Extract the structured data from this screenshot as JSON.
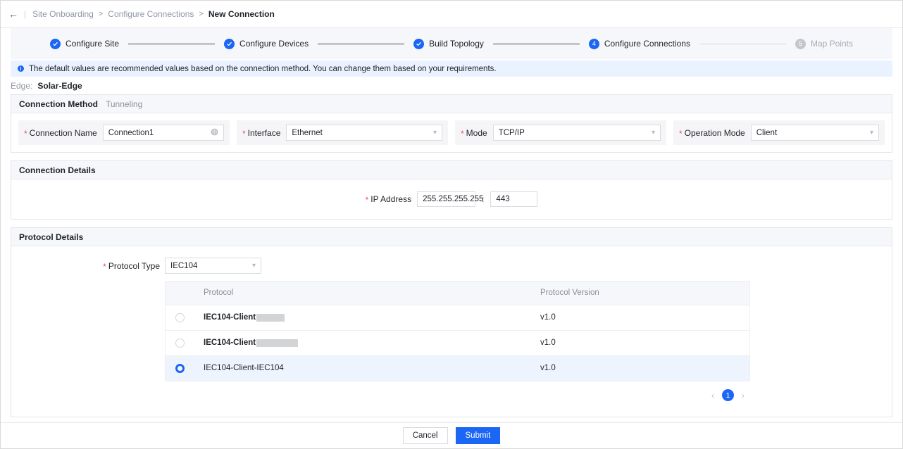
{
  "breadcrumb": {
    "back_icon": "back-arrow-icon",
    "items": [
      "Site Onboarding",
      "Configure Connections"
    ],
    "current": "New Connection",
    "separator": ">"
  },
  "stepper": {
    "steps": [
      {
        "label": "Configure Site",
        "state": "done",
        "marker": "check"
      },
      {
        "label": "Configure Devices",
        "state": "done",
        "marker": "check"
      },
      {
        "label": "Build Topology",
        "state": "done",
        "marker": "check"
      },
      {
        "label": "Configure Connections",
        "state": "active",
        "marker": "4"
      },
      {
        "label": "Map Points",
        "state": "inactive",
        "marker": "5"
      }
    ]
  },
  "info_banner": {
    "icon": "info-circle-icon",
    "text": "The default values are recommended values based on the connection method. You can change them based on your requirements."
  },
  "edge": {
    "label": "Edge:",
    "value": "Solar-Edge"
  },
  "connection_method": {
    "title": "Connection Method",
    "subtitle": "Tunneling",
    "fields": {
      "connection_name": {
        "label": "Connection Name",
        "required": true,
        "value": "Connection1",
        "icon": "globe-icon"
      },
      "interface": {
        "label": "Interface",
        "required": true,
        "value": "Ethernet",
        "options": [
          "Ethernet"
        ]
      },
      "mode": {
        "label": "Mode",
        "required": true,
        "value": "TCP/IP",
        "options": [
          "TCP/IP"
        ]
      },
      "operation_mode": {
        "label": "Operation Mode",
        "required": true,
        "value": "Client",
        "options": [
          "Client"
        ]
      }
    }
  },
  "connection_details": {
    "title": "Connection Details",
    "ip_label": "IP Address",
    "ip_required": true,
    "ip_value": "255.255.255.255",
    "separator": ":",
    "port_value": "443"
  },
  "protocol_details": {
    "title": "Protocol Details",
    "protocol_type_label": "Protocol Type",
    "protocol_type_required": true,
    "protocol_type_value": "IEC104",
    "protocol_type_options": [
      "IEC104"
    ],
    "table": {
      "columns": [
        "",
        "Protocol",
        "Protocol Version"
      ],
      "rows": [
        {
          "selected": false,
          "protocol": "IEC104-Client",
          "redacted": true,
          "redact_width": 40,
          "version": "v1.0"
        },
        {
          "selected": false,
          "protocol": "IEC104-Client",
          "redacted": true,
          "redact_width": 59,
          "version": "v1.0"
        },
        {
          "selected": true,
          "protocol": "IEC104-Client-IEC104",
          "redacted": false,
          "redact_width": 0,
          "version": "v1.0"
        }
      ]
    },
    "pagination": {
      "prev": "‹",
      "page": "1",
      "next": "›"
    }
  },
  "footer": {
    "cancel_label": "Cancel",
    "submit_label": "Submit"
  },
  "colors": {
    "accent": "#1b66f5",
    "required": "#f5455c",
    "panel_header_bg": "#f6f7fa",
    "info_bg": "#eaf2ff",
    "selected_row_bg": "#eef4fe"
  }
}
